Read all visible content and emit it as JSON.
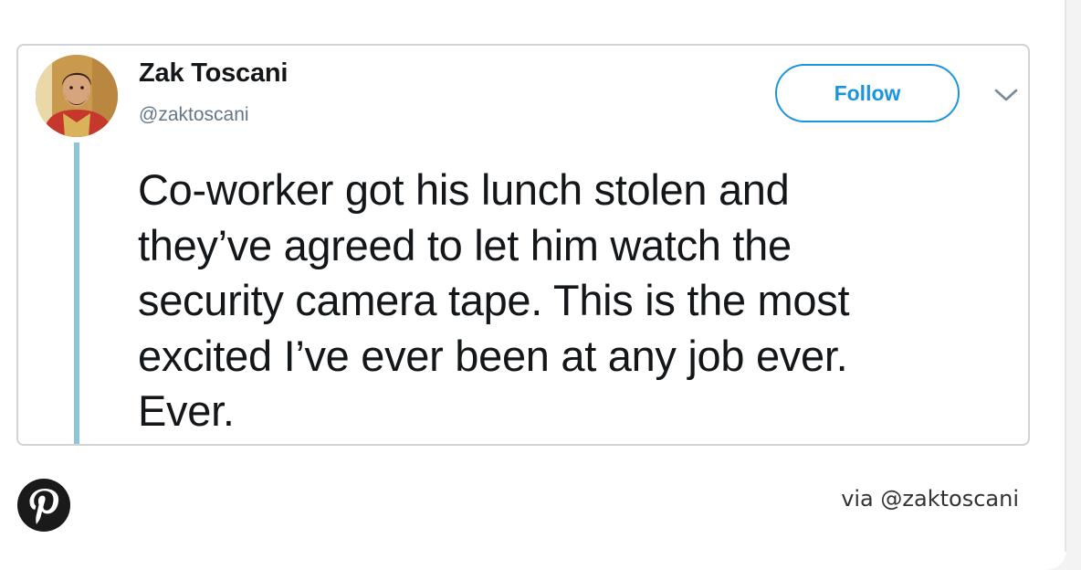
{
  "tweet": {
    "author_name": "Zak Toscani",
    "author_handle": "@zaktoscani",
    "follow_label": "Follow",
    "text_lines": [
      "Co-worker got his lunch stolen and",
      "they’ve agreed to let him watch the",
      "security camera tape. This is the most",
      "excited I’ve ever been at any job ever.",
      "Ever."
    ],
    "avatar_icon": "user-avatar",
    "menu_icon": "chevron-down-icon"
  },
  "footer": {
    "logo_icon": "pinterest-icon",
    "via_prefix": "via",
    "via_handle": "@zaktoscani"
  },
  "colors": {
    "follow_blue": "#1b95e0",
    "thread_line": "#8ec5de",
    "text_dark": "#14171a",
    "handle_gray": "#657786",
    "pinterest": "#1a1a1a"
  }
}
